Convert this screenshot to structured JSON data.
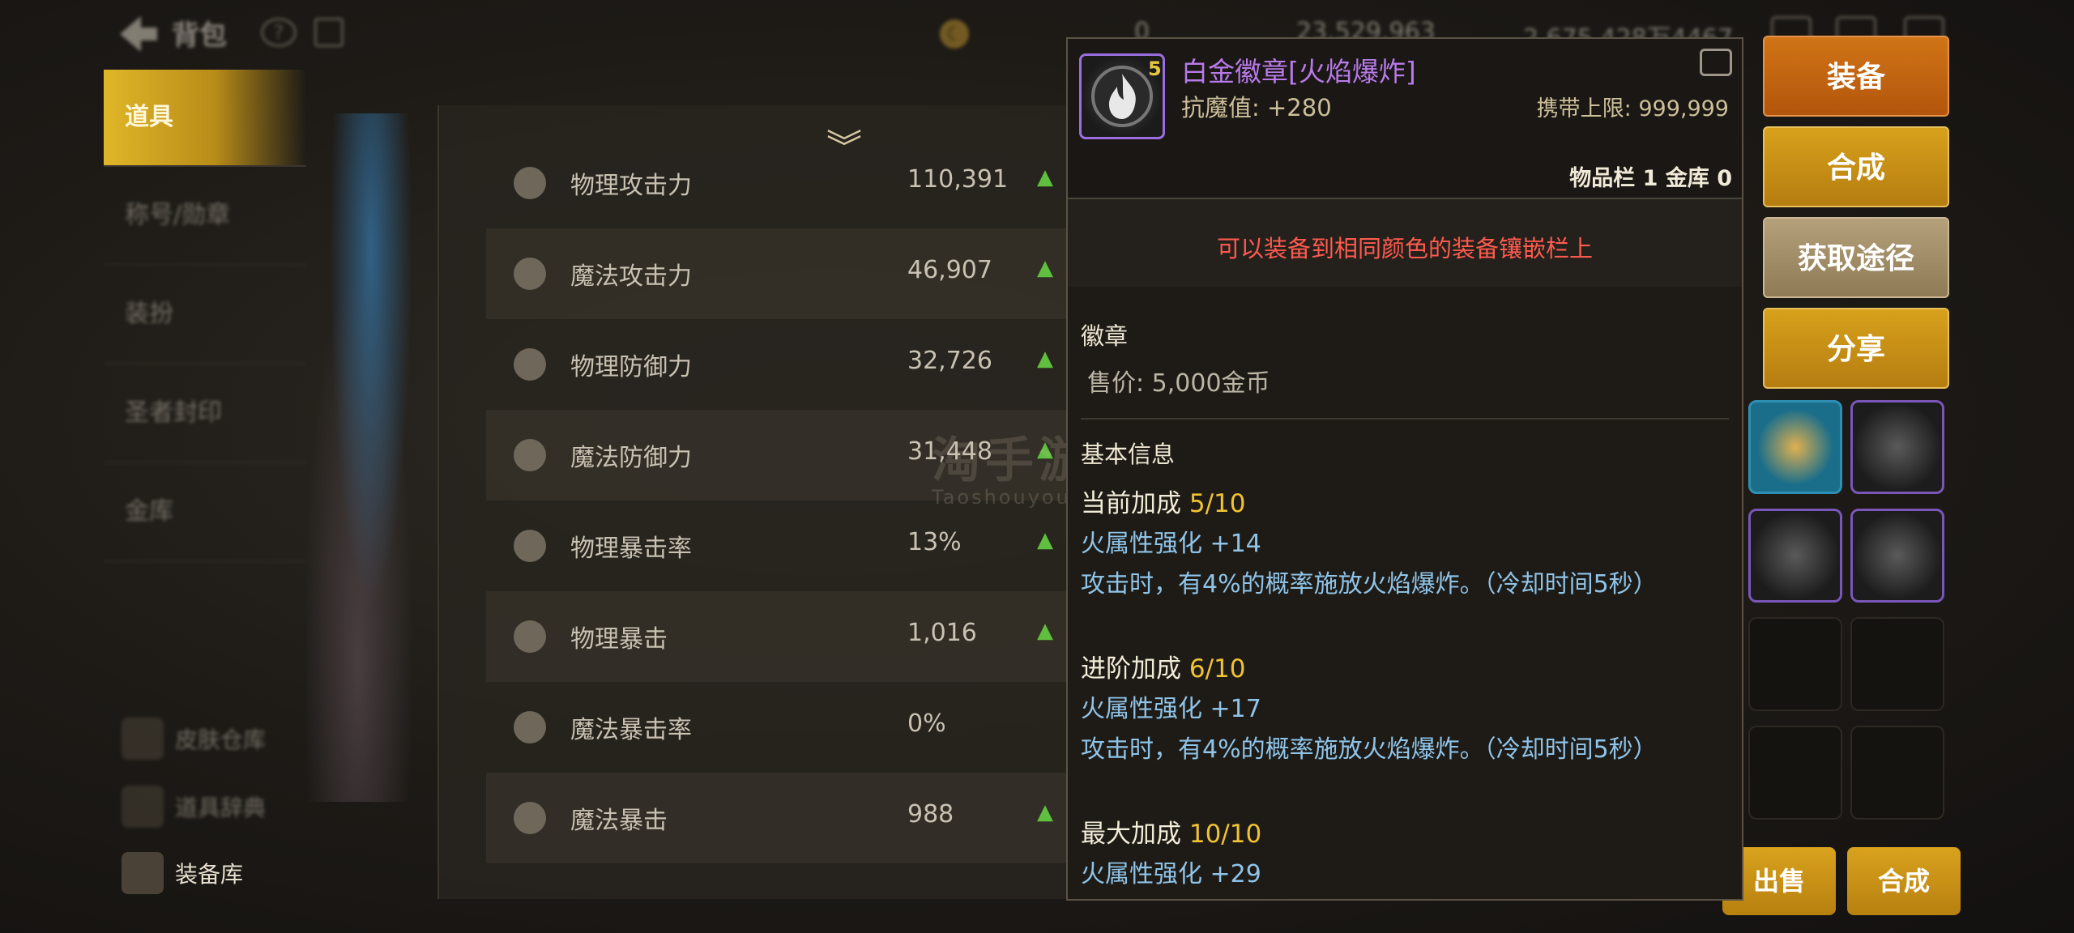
{
  "header": {
    "title": "背包",
    "currency_1": "23,529,963",
    "currency_2": "2,675,428万4467",
    "currency_0": "0"
  },
  "sidebar": {
    "tabs": [
      {
        "label": "道具"
      },
      {
        "label": "称号/勋章"
      },
      {
        "label": "装扮"
      },
      {
        "label": "圣者封印"
      },
      {
        "label": "金库"
      }
    ],
    "bottom": [
      {
        "label": "皮肤仓库"
      },
      {
        "label": "道具辞典"
      },
      {
        "label": "装备库"
      }
    ]
  },
  "stats": [
    {
      "name": "物理攻击力",
      "value": "110,391"
    },
    {
      "name": "魔法攻击力",
      "value": "46,907"
    },
    {
      "name": "物理防御力",
      "value": "32,726"
    },
    {
      "name": "魔法防御力",
      "value": "31,448"
    },
    {
      "name": "物理暴击率",
      "value": "13%"
    },
    {
      "name": "物理暴击",
      "value": "1,016"
    },
    {
      "name": "魔法暴击率",
      "value": "0%"
    },
    {
      "name": "魔法暴击",
      "value": "988"
    }
  ],
  "tooltip": {
    "item_level": "5",
    "item_name": "白金徽章[火焰爆炸]",
    "attr": "抗魔值: +280",
    "limit": "携带上限: 999,999",
    "storage": "物品栏 1 金库 0",
    "notice": "可以装备到相同颜色的装备镶嵌栏上",
    "category": "徽章",
    "price": "售价: 5,000金币",
    "basic_info": "基本信息",
    "current": {
      "label": "当前加成",
      "num": "5/10",
      "line1": "火属性强化 +14",
      "line2": "攻击时，有4%的概率施放火焰爆炸。（冷却时间5秒）"
    },
    "advanced": {
      "label": "进阶加成",
      "num": "6/10",
      "line1": "火属性强化 +17",
      "line2": "攻击时，有4%的概率施放火焰爆炸。（冷却时间5秒）"
    },
    "max": {
      "label": "最大加成",
      "num": "10/10",
      "line1": "火属性强化 +29"
    }
  },
  "actions": {
    "equip": "装备",
    "combine": "合成",
    "source": "获取途径",
    "share": "分享"
  },
  "bottom_buttons": {
    "sell": "出售",
    "merge": "合成"
  },
  "watermark": {
    "text": "淘手游",
    "sub": "Taoshouyou"
  },
  "colors": {
    "item_name": "#b77ae8",
    "notice": "#ff5a4e",
    "bonus_num": "#f1c232",
    "effect": "#8fc4e8"
  }
}
